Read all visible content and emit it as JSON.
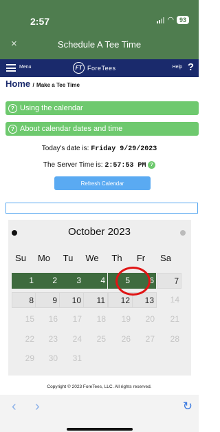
{
  "status": {
    "time": "2:57",
    "wifi_icon": "wifi-icon",
    "battery": "93"
  },
  "window": {
    "close_label": "×",
    "title": "Schedule A Tee Time"
  },
  "appbar": {
    "menu_label": "Menu",
    "logo_mark": "FT",
    "logo_text": "ForeTees",
    "help_label": "Help",
    "help_icon": "?"
  },
  "breadcrumb": {
    "home": "Home",
    "separator": "/",
    "current": "Make a Tee Time"
  },
  "info": {
    "using_calendar": "Using the calendar",
    "about_dates": "About calendar dates and time"
  },
  "today": {
    "label": "Today's date is:",
    "value": "Friday 9/29/2023"
  },
  "server": {
    "label": "The Server Time is:",
    "value": "2:57:53 PM"
  },
  "refresh_label": "Refresh Calendar",
  "calendar": {
    "month": "October 2023",
    "weekdays": [
      "Su",
      "Mo",
      "Tu",
      "We",
      "Th",
      "Fr",
      "Sa"
    ],
    "days": [
      "1",
      "2",
      "3",
      "4",
      "5",
      "6",
      "7",
      "8",
      "9",
      "10",
      "11",
      "12",
      "13",
      "14",
      "15",
      "16",
      "17",
      "18",
      "19",
      "20",
      "21",
      "22",
      "23",
      "24",
      "25",
      "26",
      "27",
      "28",
      "29",
      "30",
      "31"
    ],
    "highlighted_day": "5"
  },
  "colors": {
    "header": "#4f7d4f",
    "appbar": "#1a2a6c",
    "info": "#6ec96e",
    "available_day": "#3e6b3e",
    "highlight_ring": "#e01414",
    "button": "#5aaaf2"
  },
  "copyright": "Copyright © 2023 ForeTees, LLC. All rights reserved.",
  "browser": {
    "back": "‹",
    "forward": "›",
    "reload": "↻"
  }
}
